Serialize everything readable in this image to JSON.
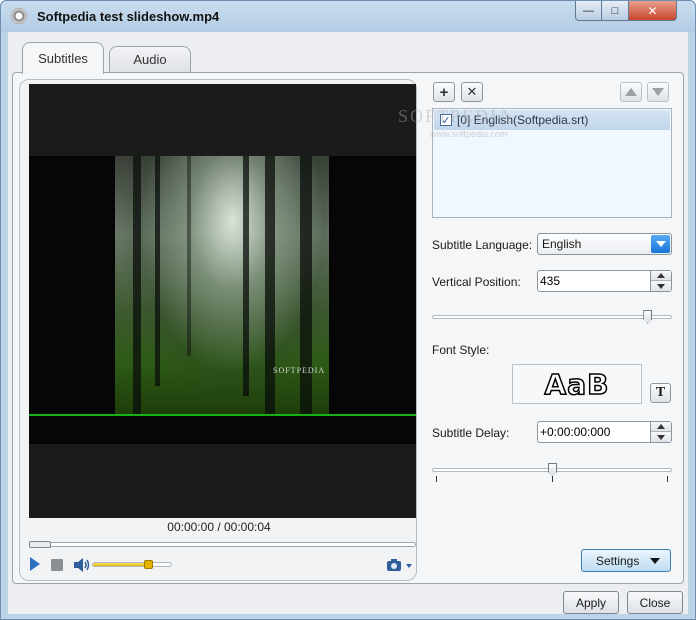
{
  "window": {
    "title": "Softpedia test slideshow.mp4"
  },
  "tabs": [
    {
      "label": "Subtitles",
      "active": true
    },
    {
      "label": "Audio",
      "active": false
    }
  ],
  "player": {
    "time_display": "00:00:00 / 00:00:04",
    "volume_fraction": 0.7,
    "seek_fraction": 0.0,
    "subtitle_line_color": "#17b117",
    "video_logo": "SOFTPEDIA"
  },
  "subtitles": {
    "items": [
      {
        "label": "[0] English(Softpedia.srt)",
        "checked": true
      }
    ],
    "language_label": "Subtitle Language:",
    "language_value": "English",
    "vertical_position_label": "Vertical Position:",
    "vertical_position_value": "435",
    "vertical_slider_fraction": 0.9,
    "font_style_label": "Font Style:",
    "font_preview_text": "AaB",
    "font_button_label": "T",
    "delay_label": "Subtitle Delay:",
    "delay_value": "+0:00:00:000",
    "delay_slider_fraction": 0.5
  },
  "watermark": {
    "text": "SOFTPEDIA",
    "url": "www.softpedia.com"
  },
  "buttons": {
    "settings": "Settings",
    "apply": "Apply",
    "close": "Close"
  },
  "colors": {
    "accent": "#1676d8",
    "play": "#2f6fc0",
    "volume": "#e2b800"
  }
}
